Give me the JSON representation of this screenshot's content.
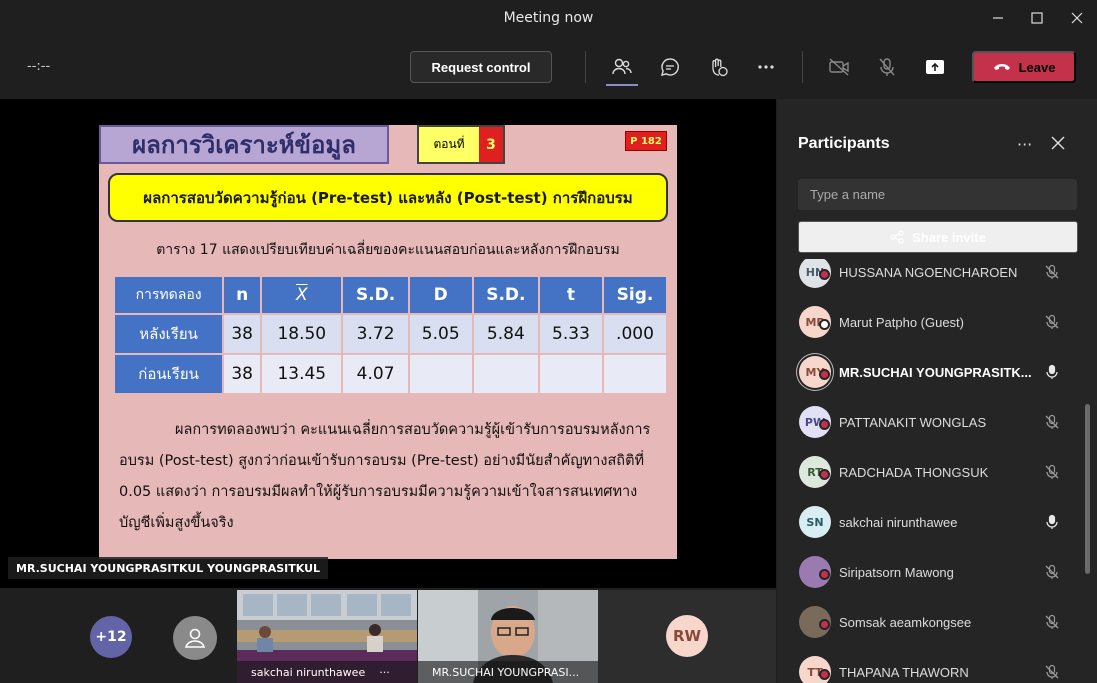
{
  "window": {
    "title": "Meeting now"
  },
  "toolbar": {
    "timer": "--:--",
    "request_control_label": "Request control",
    "leave_label": "Leave"
  },
  "slide": {
    "title": "ผลการวิเคราะห์ข้อมูล",
    "part_label": "ตอนที่",
    "part_number": "3",
    "page_badge": "P 182",
    "subtitle": "ผลการสอบวัดความรู้ก่อน (Pre-test) และหลัง (Post-test) การฝึกอบรม",
    "caption": "ตาราง 17 แสดงเปรียบเทียบค่าเฉลี่ยของคะแนนสอบก่อนและหลังการฝึกอบรม",
    "table": {
      "headers": [
        "การทดลอง",
        "n",
        "X",
        "S.D.",
        "D",
        "S.D.",
        "t",
        "Sig."
      ],
      "rows": [
        [
          "หลังเรียน",
          "38",
          "18.50",
          "3.72",
          "5.05",
          "5.84",
          "5.33",
          ".000"
        ],
        [
          "ก่อนเรียน",
          "38",
          "13.45",
          "4.07",
          "",
          "",
          "",
          ""
        ]
      ]
    },
    "paragraph": "ผลการทดลองพบว่า คะแนนเฉลี่ยการสอบวัดความรู้ผู้เข้ารับการอบรมหลังการอบรม (Post-test) สูงกว่าก่อนเข้ารับการอบรม (Pre-test) อย่างมีนัยสำคัญทางสถิติที่ 0.05 แสดงว่า การอบรมมีผลทำให้ผู้รับการอบรมมีความรู้ความเข้าใจสารสนเทศทางบัญชีเพิ่มสูงขึ้นจริง"
  },
  "presenter_tag": "MR.SUCHAI YOUNGPRASITKUL YOUNGPRASITKUL",
  "strip": {
    "more_count": "+12",
    "tiles": [
      {
        "name": "sakchai nirunthawee",
        "more": "···"
      },
      {
        "name": "MR.SUCHAI YOUNGPRASI..."
      }
    ],
    "rw_initials": "RW"
  },
  "panel": {
    "title": "Participants",
    "more": "···",
    "search_placeholder": "Type a name",
    "share_label": "Share invite",
    "participants": [
      {
        "initials": "HN",
        "name": "HUSSANA NGOENCHAROEN",
        "avatar_bg": "#dfe3e8",
        "avatar_fg": "#4a5a6a",
        "status": "#c4314b",
        "mic": "muted",
        "bold": false
      },
      {
        "initials": "MP",
        "name": "Marut Patpho (Guest)",
        "avatar_bg": "#f7d6cc",
        "avatar_fg": "#8a4a3a",
        "status": "#ffffff",
        "mic": "muted",
        "bold": false
      },
      {
        "initials": "MY",
        "name": "MR.SUCHAI YOUNGPRASITK...",
        "avatar_bg": "#f7d6cc",
        "avatar_fg": "#8a4a3a",
        "status": "#c4314b",
        "mic": "on",
        "bold": true
      },
      {
        "initials": "PW",
        "name": "PATTANAKIT WONGLAS",
        "avatar_bg": "#e2e0f5",
        "avatar_fg": "#4a4a8a",
        "status": "#c4314b",
        "mic": "muted",
        "bold": false
      },
      {
        "initials": "RT",
        "name": "RADCHADA THONGSUK",
        "avatar_bg": "#dde8dd",
        "avatar_fg": "#3a5a3a",
        "status": "#c4314b",
        "mic": "muted",
        "bold": false
      },
      {
        "initials": "SN",
        "name": "sakchai nirunthawee",
        "avatar_bg": "#d9eef2",
        "avatar_fg": "#2a5a66",
        "status": "",
        "mic": "on",
        "bold": false
      },
      {
        "initials": "",
        "name": "Siripatsorn Mawong",
        "avatar_bg": "#9a7ab0",
        "avatar_fg": "#ffffff",
        "status": "#c4314b",
        "mic": "muted",
        "bold": false
      },
      {
        "initials": "",
        "name": "Somsak aeamkongsee",
        "avatar_bg": "#7a6a5a",
        "avatar_fg": "#ffffff",
        "status": "#c4314b",
        "mic": "muted",
        "bold": false
      },
      {
        "initials": "TT",
        "name": "THAPANA THAWORN",
        "avatar_bg": "#f7d6cc",
        "avatar_fg": "#8a4a3a",
        "status": "#c4314b",
        "mic": "muted",
        "bold": false
      }
    ]
  }
}
